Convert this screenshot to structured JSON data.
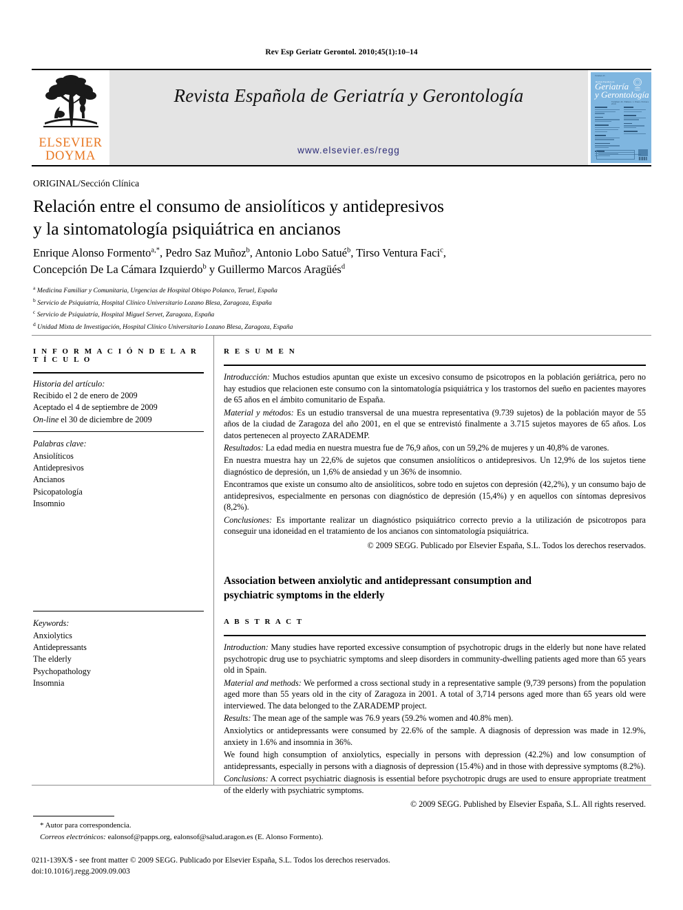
{
  "running_head": "Rev Esp Geriatr Gerontol. 2010;45(1):10–14",
  "masthead": {
    "publisher_line1": "ELSEVIER",
    "publisher_line2": "DOYMA",
    "journal_title": "Revista Española de Geriatría y Gerontología",
    "journal_url": "www.elsevier.es/regg",
    "band_color": "#e4e4e4",
    "publisher_color": "#e87722",
    "url_color": "#2d2d78",
    "cover": {
      "top_label": "Volumen 45",
      "masthead_small": "Revista Española de",
      "title_line1": "Geriatría",
      "title_line2": "y Gerontología",
      "issue_line": "Volumen 45. Número 1. Enero-Febrero 2010",
      "background_color": "#7fb6e0"
    }
  },
  "kicker": "ORIGINAL/Sección Clínica",
  "title": {
    "line1": "Relación entre el consumo de ansiolíticos y antidepresivos",
    "line2": "y la sintomatología psiquiátrica en ancianos"
  },
  "authors": {
    "line1_parts": [
      {
        "name": "Enrique Alonso Formento",
        "sup": "a,*"
      },
      {
        "name": "Pedro Saz Muñoz",
        "sup": "b"
      },
      {
        "name": "Antonio Lobo Satué",
        "sup": "b"
      },
      {
        "name": "Tirso Ventura Faci",
        "sup": "c"
      }
    ],
    "line2_parts": [
      {
        "name": "Concepción De La Cámara Izquierdo",
        "sup": "b"
      },
      {
        "name": "y Guillermo Marcos Aragüés",
        "sup": "d"
      }
    ]
  },
  "affiliations": [
    {
      "mark": "a",
      "text": "Medicina Familiar y Comunitaria, Urgencias de Hospital Obispo Polanco, Teruel, España"
    },
    {
      "mark": "b",
      "text": "Servicio de Psiquiatría, Hospital Clínico Universitario Lozano Blesa, Zaragoza, España"
    },
    {
      "mark": "c",
      "text": "Servicio de Psiquiatría, Hospital Miguel Servet, Zaragoza, España"
    },
    {
      "mark": "d",
      "text": "Unidad Mixta de Investigación, Hospital Clínico Universitario Lozano Blesa, Zaragoza, España"
    }
  ],
  "info_column": {
    "heading": "I N F O R M A C I Ó N   D E L   A R T Í C U L O",
    "history_label": "Historia del artículo:",
    "history": [
      "Recibido el 2 de enero de 2009",
      "Aceptado el 4 de septiembre de 2009"
    ],
    "online_prefix": "On-line",
    "online_rest": " el 30 de diciembre de 2009",
    "keywords_label": "Palabras clave:",
    "keywords": [
      "Ansiolíticos",
      "Antidepresivos",
      "Ancianos",
      "Psicopatología",
      "Insomnio"
    ],
    "keywords_en_label": "Keywords:",
    "keywords_en": [
      "Anxiolytics",
      "Antidepressants",
      "The elderly",
      "Psychopathology",
      "Insomnia"
    ]
  },
  "abstract_es": {
    "heading": "R E S U M E N",
    "paragraphs": [
      {
        "label": "Introducción:",
        "text": " Muchos estudios apuntan que existe un excesivo consumo de psicotropos en la población geriátrica, pero no hay estudios que relacionen este consumo con la sintomatología psiquiátrica y los trastornos del sueño en pacientes mayores de 65 años en el ámbito comunitario de España."
      },
      {
        "label": "Material y métodos:",
        "text": " Es un estudio transversal de una muestra representativa (9.739 sujetos) de la población mayor de 55 años de la ciudad de Zaragoza del año 2001, en el que se entrevistó finalmente a 3.715 sujetos mayores de 65 años. Los datos pertenecen al proyecto ZARADEMP."
      },
      {
        "label": "Resultados:",
        "text": " La edad media en nuestra muestra fue de 76,9 años, con un 59,2% de mujeres y un 40,8% de varones."
      },
      {
        "label": "",
        "text": "En nuestra muestra hay un 22,6% de sujetos que consumen ansiolíticos o antidepresivos. Un 12,9% de los sujetos tiene diagnóstico de depresión, un 1,6% de ansiedad y un 36% de insomnio."
      },
      {
        "label": "",
        "text": "Encontramos que existe un consumo alto de ansiolíticos, sobre todo en sujetos con depresión (42,2%), y un consumo bajo de antidepresivos, especialmente en personas con diagnóstico de depresión (15,4%) y en aquellos con síntomas depresivos (8,2%)."
      },
      {
        "label": "Conclusiones:",
        "text": " Es importante realizar un diagnóstico psiquiátrico correcto previo a la utilización de psicotropos para conseguir una idoneidad en el tratamiento de los ancianos con sintomatología psiquiátrica."
      }
    ],
    "copyright": "© 2009 SEGG. Publicado por Elsevier España, S.L. Todos los derechos reservados."
  },
  "english": {
    "title_line1": "Association between anxiolytic and antidepressant consumption and",
    "title_line2": "psychiatric symptoms in the elderly",
    "heading": "A B S T R A C T",
    "paragraphs": [
      {
        "label": "Introduction:",
        "text": " Many studies have reported excessive consumption of psychotropic drugs in the elderly but none have related psychotropic drug use to psychiatric symptoms and sleep disorders in community-dwelling patients aged more than 65 years old in Spain."
      },
      {
        "label": "Material and methods:",
        "text": " We performed a cross sectional study in a representative sample (9,739 persons) from the population aged more than 55 years old in the city of Zaragoza in 2001. A total of 3,714 persons aged more than 65 years old were interviewed. The data belonged to the ZARADEMP project."
      },
      {
        "label": "Results:",
        "text": " The mean age of the sample was 76.9 years (59.2% women and 40.8% men)."
      },
      {
        "label": "",
        "text": "Anxiolytics or antidepressants were consumed by 22.6% of the sample. A diagnosis of depression was made in 12.9%, anxiety in 1.6% and insomnia in 36%."
      },
      {
        "label": "",
        "text": "We found high consumption of anxiolytics, especially in persons with depression (42.2%) and low consumption of antidepressants, especially in persons with a diagnosis of depression (15.4%) and in those with depressive symptoms (8.2%)."
      },
      {
        "label": "Conclusions:",
        "text": " A correct psychiatric diagnosis is essential before psychotropic drugs are used to ensure appropriate treatment of the elderly with psychiatric symptoms."
      }
    ],
    "copyright": "© 2009 SEGG. Published by Elsevier España, S.L. All rights reserved."
  },
  "footer": {
    "corresponding_mark": "*",
    "corresponding_text": " Autor para correspondencia.",
    "email_label": "Correos electrónicos:",
    "email_text": " ealonsof@papps.org, ealonsof@salud.aragon.es (E. Alonso Formento).",
    "imprint_line1": "0211-139X/$ - see front matter © 2009 SEGG. Publicado por Elsevier España, S.L. Todos los derechos reservados.",
    "imprint_line2": "doi:10.1016/j.regg.2009.09.003"
  }
}
